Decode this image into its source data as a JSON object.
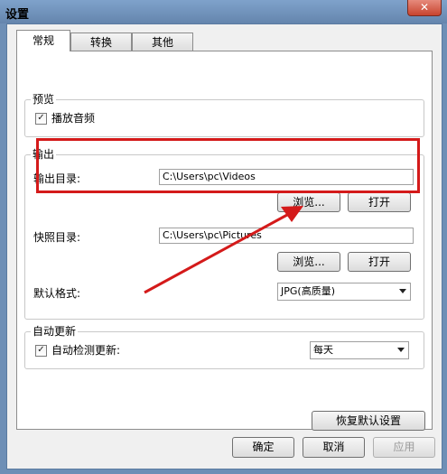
{
  "window": {
    "title": "设置",
    "close_glyph": "✕"
  },
  "tabs": [
    {
      "label": "常规",
      "active": true
    },
    {
      "label": "转换",
      "active": false
    },
    {
      "label": "其他",
      "active": false
    }
  ],
  "preview": {
    "title": "预览",
    "play_audio_label": "播放音频",
    "play_audio_checked": true
  },
  "output": {
    "title": "输出",
    "output_dir_label": "输出目录:",
    "output_dir_value": "C:\\Users\\pc\\Videos",
    "browse_label": "浏览...",
    "open_label": "打开",
    "snapshot_dir_label": "快照目录:",
    "snapshot_dir_value": "C:\\Users\\pc\\Pictures",
    "default_format_label": "默认格式:",
    "default_format_value": "JPG(高质量)"
  },
  "auto_update": {
    "title": "自动更新",
    "auto_check_label": "自动检测更新:",
    "auto_check_checked": true,
    "frequency_value": "每天"
  },
  "restore_defaults_label": "恢复默认设置",
  "footer": {
    "ok_label": "确定",
    "cancel_label": "取消",
    "apply_label": "应用"
  },
  "annotation": {
    "highlight_color": "#d41a1a"
  }
}
